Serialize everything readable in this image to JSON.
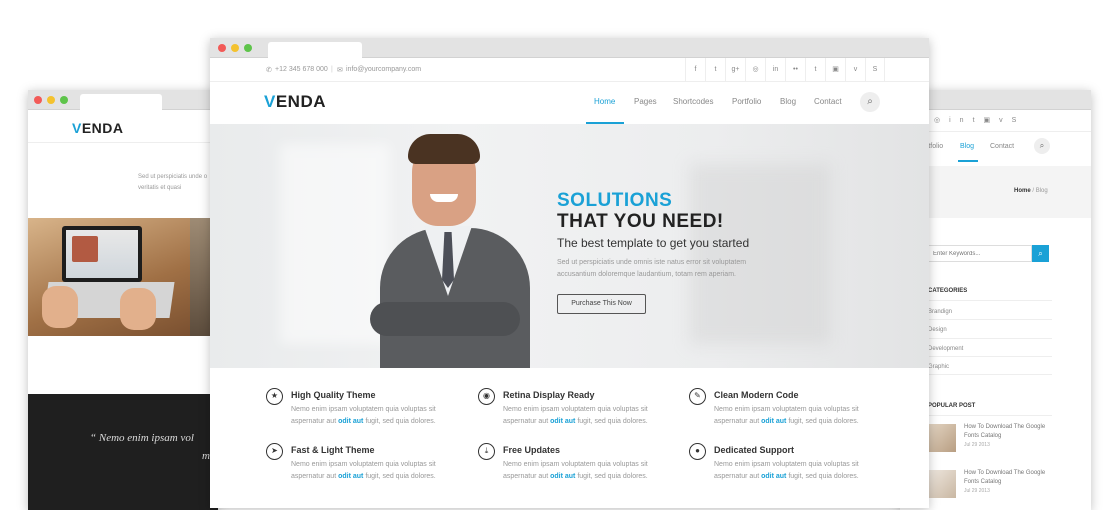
{
  "brand": {
    "letter": "V",
    "rest": "ENDA"
  },
  "colors": {
    "accent": "#1aa1d6",
    "dark": "#222222"
  },
  "left_window": {
    "text_lines": [
      "Sed ut perspiciatis unde o",
      "veritatis et quasi"
    ],
    "quote": "“ Nemo enim ipsam vol",
    "quote2": "m"
  },
  "main_window": {
    "topbar": {
      "phone": "+12 345 678 000",
      "email": "info@yourcompany.com",
      "social": [
        "f",
        "t",
        "g+",
        "◎",
        "in",
        "••",
        "t",
        "▣",
        "v",
        "S"
      ]
    },
    "nav": [
      "Home",
      "Pages",
      "Shortcodes",
      "Portfolio",
      "Blog",
      "Contact"
    ],
    "active_nav": "Home",
    "hero": {
      "title1": "SOLUTIONS",
      "title2": "THAT YOU NEED!",
      "subtitle": "The best template to get you started",
      "desc1": "Sed ut perspiciatis unde omnis iste natus error sit voluptatem",
      "desc2": "accusantium doloremque laudantium, totam rem aperiam.",
      "button": "Purchase This Now"
    },
    "features": [
      {
        "icon": "star-icon",
        "glyph": "★",
        "title": "High Quality Theme"
      },
      {
        "icon": "eye-icon",
        "glyph": "◉",
        "title": "Retina Display Ready"
      },
      {
        "icon": "pencil-icon",
        "glyph": "✎",
        "title": "Clean Modern Code"
      },
      {
        "icon": "send-icon",
        "glyph": "➤",
        "title": "Fast & Light Theme"
      },
      {
        "icon": "download-icon",
        "glyph": "⤓",
        "title": "Free Updates"
      },
      {
        "icon": "user-icon",
        "glyph": "●",
        "title": "Dedicated Support"
      }
    ],
    "feature_desc": {
      "line1": "Nemo enim ipsam voluptatem quia voluptas sit",
      "line2a": "aspernatur aut ",
      "highlight": "odit aut",
      "line2b": " fugit, sed quia dolores."
    }
  },
  "right_window": {
    "social": [
      "◎",
      "in",
      "t",
      "▣",
      "v",
      "S"
    ],
    "nav": [
      "rtfolio",
      "Blog",
      "Contact"
    ],
    "breadcrumb": {
      "home": "Home",
      "sep": " / ",
      "current": "Blog"
    },
    "search_placeholder": "Enter Keywords...",
    "categories_title": "CATEGORIES",
    "categories": [
      "Brandign",
      "Design",
      "Development",
      "Graphic"
    ],
    "popular_title": "POPULAR POST",
    "posts": [
      {
        "title1": "How To Download The Google",
        "title2": "Fonts Catalog",
        "date": "Jul 29 2013"
      },
      {
        "title1": "How To Download The Google",
        "title2": "Fonts Catalog",
        "date": "Jul 29 2013"
      }
    ]
  }
}
